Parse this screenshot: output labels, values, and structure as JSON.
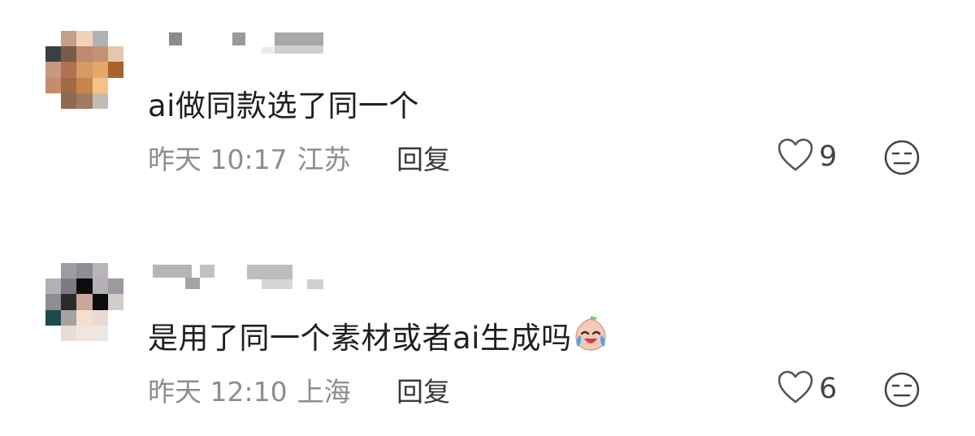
{
  "comments": [
    {
      "text": "ai做同款选了同一个",
      "time": "昨天 10:17",
      "location": "江苏",
      "reply_label": "回复",
      "like_count": "9",
      "avatar_colors": [
        "#ffffff",
        "#c79f86",
        "#f0d2b9",
        "#aeb2b8",
        "#ffffff",
        "#3b3f44",
        "#7b5a4a",
        "#bf8a6f",
        "#c69274",
        "#e7c7aa",
        "#c79882",
        "#b27152",
        "#d39a6a",
        "#e6a86a",
        "#a9622e",
        "#c68c6b",
        "#9d6a43",
        "#c7844a",
        "#f4c288",
        "#ffffff",
        "#ffffff",
        "#8e6a55",
        "#a07a60",
        "#c4bcb3",
        "#ffffff"
      ]
    },
    {
      "text": "是用了同一个素材或者ai生成吗",
      "time": "昨天 12:10",
      "location": "上海",
      "reply_label": "回复",
      "like_count": "6",
      "avatar_colors": [
        "#ffffff",
        "#9e9ca2",
        "#8f8c93",
        "#b7b5bb",
        "#ffffff",
        "#b3b1b6",
        "#7d7b81",
        "#0c0c0e",
        "#b5b0b5",
        "#9c9aa0",
        "#8e8d90",
        "#2a2a2c",
        "#caa59b",
        "#0d0d0f",
        "#d3ccc8",
        "#1e4a4a",
        "#a6a2a0",
        "#f2dfd0",
        "#e8dad0",
        "#ffffff",
        "#ffffff",
        "#e8ddd3",
        "#efe6df",
        "#ece7e2",
        "#ffffff"
      ]
    }
  ],
  "icons": {
    "like": "heart-outline-icon",
    "dislike": "neutral-face-icon",
    "inline_emoji": "crying-laughing-peach-emoji"
  }
}
